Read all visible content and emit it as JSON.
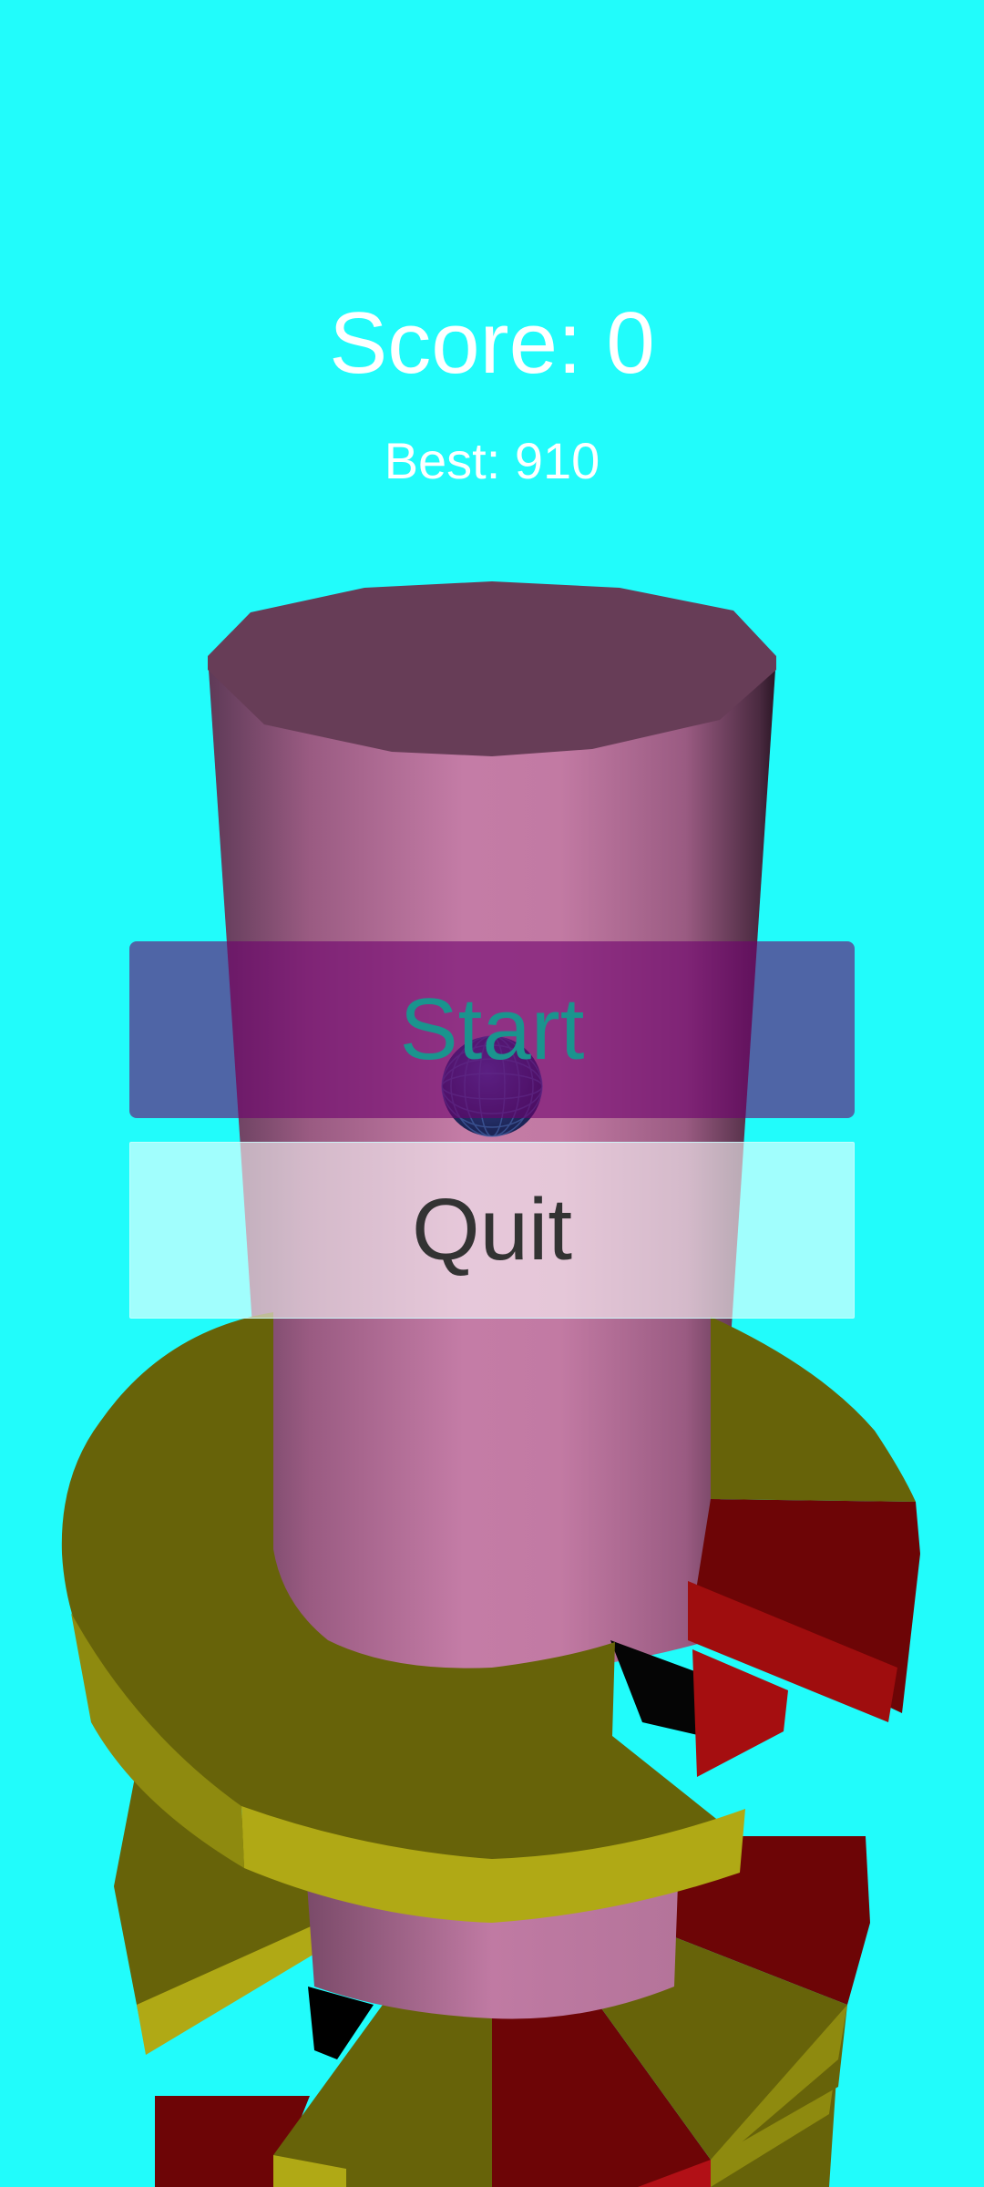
{
  "hud": {
    "score_text": "Score: 0",
    "best_text": "Best: 910"
  },
  "menu": {
    "start_label": "Start",
    "quit_label": "Quit"
  },
  "colors": {
    "sky": "#21fcfb",
    "pillar": "#c07aa3",
    "pillar_top": "#673d57",
    "safe_platform": "#676309",
    "safe_platform_edge": "#b0a915",
    "danger_platform": "#6d0506",
    "danger_platform_edge": "#9f0d0e",
    "ball": "#2a3a7a",
    "start_button_bg": "#6e006e",
    "start_button_text": "#1a948e",
    "quit_button_text": "#333333"
  }
}
